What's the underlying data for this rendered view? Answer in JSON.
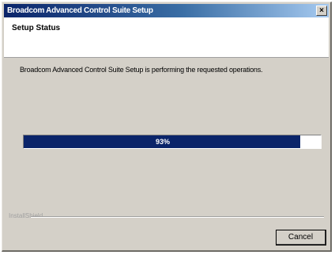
{
  "window": {
    "title": "Broadcom Advanced Control Suite Setup",
    "close_glyph": "×"
  },
  "header": {
    "title": "Setup Status"
  },
  "status": {
    "message": "Broadcom Advanced Control Suite Setup is performing the requested operations."
  },
  "progress": {
    "percent": 93,
    "label": "93%"
  },
  "footer": {
    "brand": "InstallShield"
  },
  "buttons": {
    "cancel_label": "Cancel"
  },
  "colors": {
    "titlebar_start": "#0a246a",
    "titlebar_end": "#a6caf0",
    "progress_fill": "#0a246a",
    "dialog_bg": "#d4d0c8"
  },
  "icons": {
    "close": "close-icon"
  }
}
